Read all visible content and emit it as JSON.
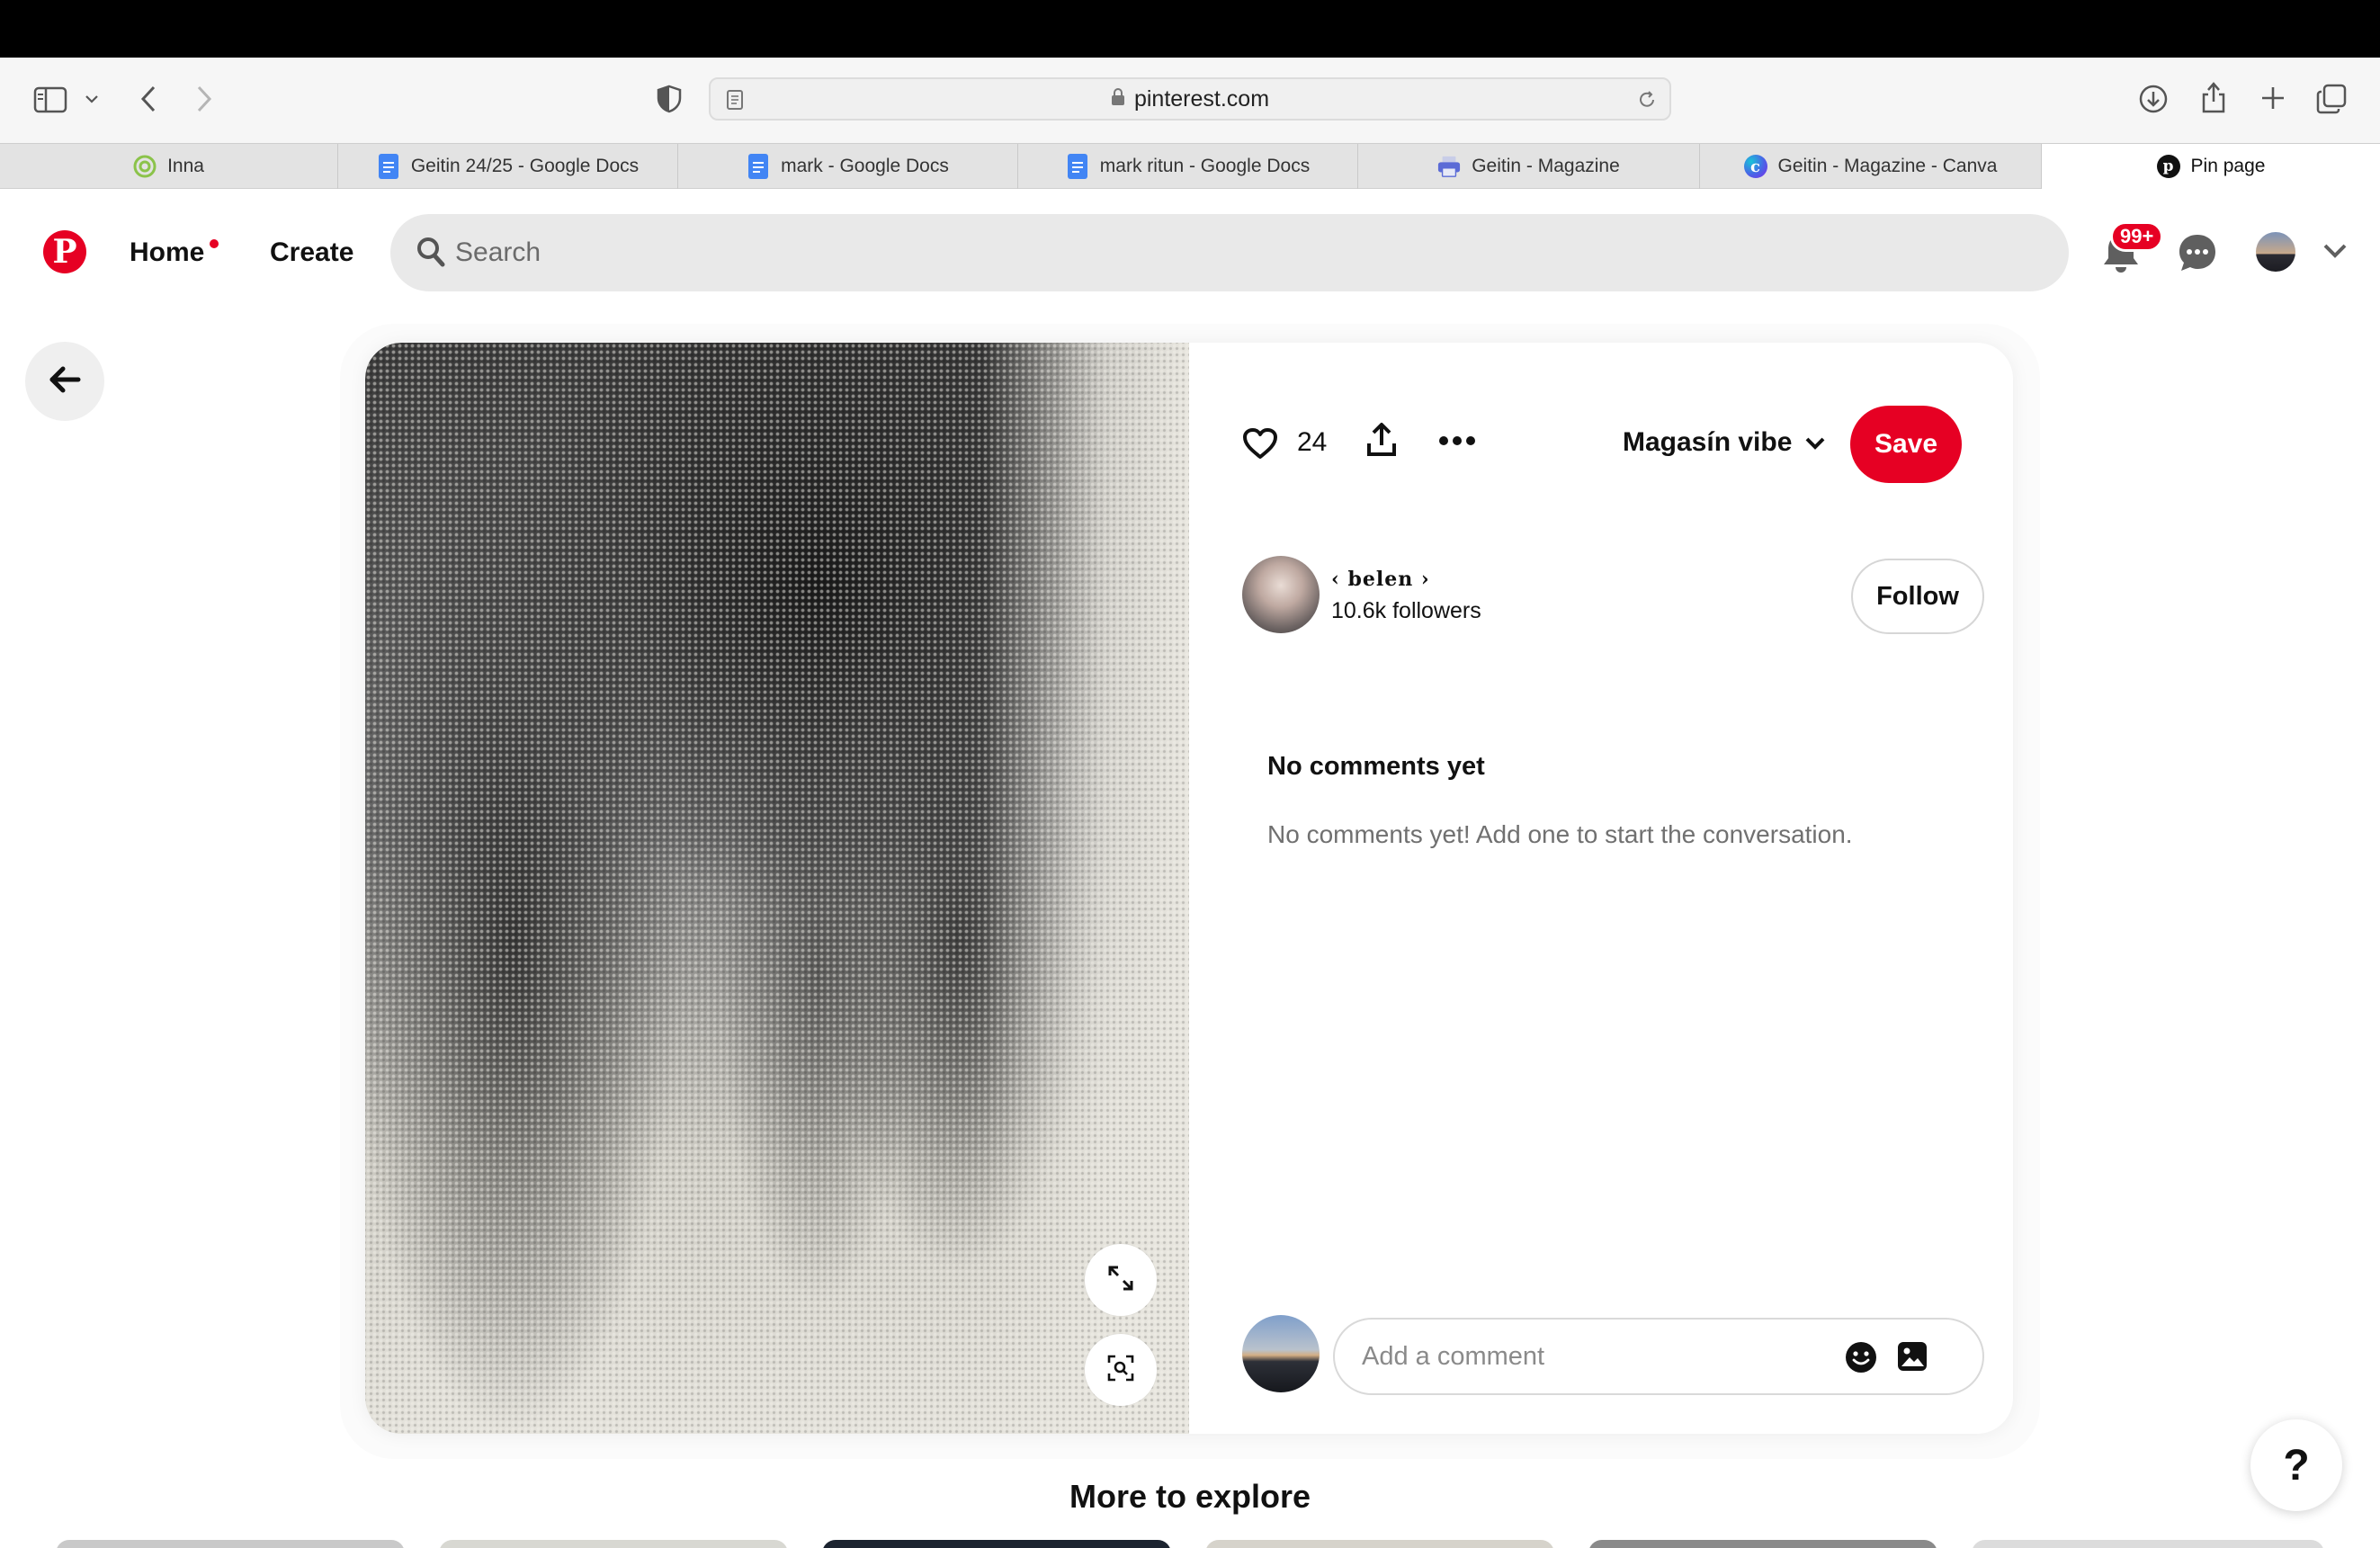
{
  "browser": {
    "url": "pinterest.com",
    "tabs": [
      {
        "label": "Inna",
        "icon": "target-icon",
        "color": "#8bc34a"
      },
      {
        "label": "Geitin 24/25 - Google Docs",
        "icon": "google-docs-icon",
        "color": "#4285f4"
      },
      {
        "label": "mark - Google Docs",
        "icon": "google-docs-icon",
        "color": "#4285f4"
      },
      {
        "label": "mark ritun - Google Docs",
        "icon": "google-docs-icon",
        "color": "#4285f4"
      },
      {
        "label": "Geitin - Magazine",
        "icon": "printer-icon",
        "color": "#5b6bd6"
      },
      {
        "label": "Geitin - Magazine - Canva",
        "icon": "canva-icon",
        "color": "#7d2ae8"
      },
      {
        "label": "Pin page",
        "icon": "pinterest-icon",
        "color": "#111111"
      }
    ]
  },
  "header": {
    "logo": "P",
    "home": "Home",
    "create": "Create",
    "search_placeholder": "Search",
    "notifications_badge": "99+",
    "brand_color": "#e60023"
  },
  "pin": {
    "likes": "24",
    "board": "Magasín vibe",
    "save": "Save",
    "creator_name": "‹ belen ›",
    "creator_followers": "10.6k followers",
    "follow": "Follow",
    "comments_title": "No comments yet",
    "comments_empty": "No comments yet! Add one to start the conversation.",
    "comment_placeholder": "Add a comment"
  },
  "explore": {
    "title": "More to explore"
  },
  "help": "?"
}
